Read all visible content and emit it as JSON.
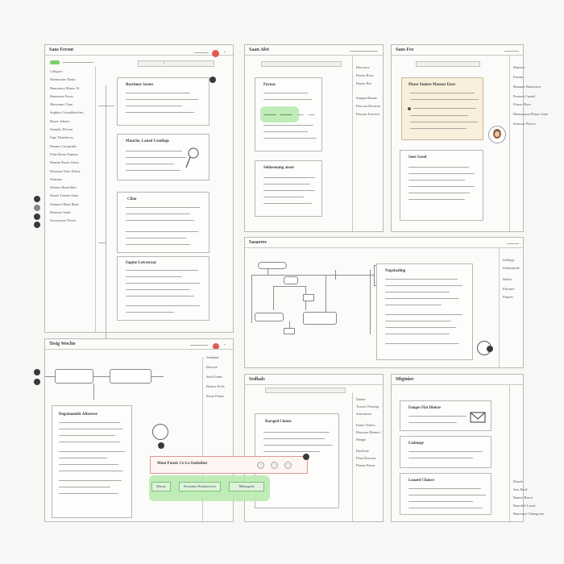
{
  "colors": {
    "background": "#f7f7f5",
    "panel_border": "#b9b9b5",
    "green_highlight": "#b9eab0",
    "orange_card": "#f8efdc",
    "notification_red": "#e05a4e"
  },
  "panel_a": {
    "title": "Sans Fersnt",
    "sidebar": [
      "Calipyre",
      "Shemonars Nasin",
      "Bamonors Mases Al",
      "Bansimes Foros",
      "Mesceme Cline",
      "Sophies Camsblenches",
      "Rusee Jebetrs",
      "Stenalic Filcore",
      "Sige Tlenebeors",
      "Pannes Corepcalis",
      "Flate Rrsse Pamees",
      "Bamne Slares Sinse",
      "Deuaton Nase Edeus",
      "Slansme",
      "Sleeme Beneclhor",
      "Seatre Tramei Sune",
      "Stanmor Rans Rane",
      "Renmoe Sunlr",
      "Sivonyrose Poves"
    ],
    "cards": [
      {
        "title": "Boschoey Sastes"
      },
      {
        "title": "Manche, Laned Ceadlags"
      },
      {
        "title": "Cilao"
      },
      {
        "title": "Sagme Leicseraar"
      }
    ]
  },
  "panel_b": {
    "title": "Saan Afet",
    "card1": "Parnas",
    "card2": "Selinsenang anser",
    "side": [
      "Dascaros",
      "Pasaie Rose",
      "Pasaie Bse",
      "Saagen Basaie",
      "Pascion Bscmon",
      "Pascaio Ereveot"
    ]
  },
  "panel_c": {
    "title": "Sans Fee",
    "orange_card": "Phase Stoiere Mansor Ence",
    "card2": "Seee Gesel",
    "side": [
      "Bansioe",
      "Paraan",
      "Beaaure Bameneor",
      "Penares Cuneil",
      "Plasse Plore",
      "Blaaneuron Plasse Sane",
      "Seseroir Plosve"
    ]
  },
  "panel_d": {
    "title": "Sasaeres",
    "card": "Napslaaling",
    "side": [
      "Sielings",
      "Sehnsmiole",
      "Betles",
      "Plisoner",
      "Plaavis"
    ]
  },
  "panel_e": {
    "title": "Tesig Woclto",
    "card": "Dogannanelic Afloresse",
    "side": [
      "Jeedanal",
      "Bersine",
      "Sebi Fonns",
      "Beetoe Foils",
      "Stoae Pasan"
    ],
    "popup_title": "Moot Ponsis Ce-Le Seafolitor",
    "buttons": [
      "Blasne",
      "Slonomac Bonimeereos",
      "Mlbaegnoh"
    ]
  },
  "panel_f": {
    "title": "Sedbals",
    "card": "Rarsged Cinons",
    "side": [
      "Daebe",
      "Toorea Thesing",
      "Sesitonten",
      "Fasne Nolers",
      "Reasoon Bieneri",
      "Sbegte",
      "Bacllone",
      "Plaat Dirertor",
      "Plaeae Faren"
    ]
  },
  "panel_g": {
    "title": "Migtnier",
    "cards": [
      "Eunges Flat Diniste",
      "Liabnege",
      "Loaaed Cliance"
    ],
    "side": [
      "Dasete",
      "Sest Berd",
      "Bantee Rrece",
      "Baretfelt Laose",
      "Banceaye Cbnegoote"
    ]
  }
}
